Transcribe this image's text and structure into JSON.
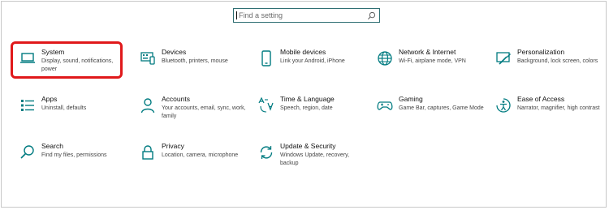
{
  "search": {
    "placeholder": "Find a setting"
  },
  "tiles": [
    {
      "title": "System",
      "desc": "Display, sound, notifications, power",
      "icon": "laptop-icon"
    },
    {
      "title": "Devices",
      "desc": "Bluetooth, printers, mouse",
      "icon": "devices-icon"
    },
    {
      "title": "Mobile devices",
      "desc": "Link your Android, iPhone",
      "icon": "phone-icon"
    },
    {
      "title": "Network & Internet",
      "desc": "Wi-Fi, airplane mode, VPN",
      "icon": "globe-icon"
    },
    {
      "title": "Personalization",
      "desc": "Background, lock screen, colors",
      "icon": "paint-icon"
    },
    {
      "title": "Apps",
      "desc": "Uninstall, defaults",
      "icon": "apps-list-icon"
    },
    {
      "title": "Accounts",
      "desc": "Your accounts, email, sync, work, family",
      "icon": "person-icon"
    },
    {
      "title": "Time & Language",
      "desc": "Speech, region, date",
      "icon": "time-language-icon"
    },
    {
      "title": "Gaming",
      "desc": "Game Bar, captures, Game Mode",
      "icon": "gamepad-icon"
    },
    {
      "title": "Ease of Access",
      "desc": "Narrator, magnifier, high contrast",
      "icon": "ease-of-access-icon"
    },
    {
      "title": "Search",
      "desc": "Find my files, permissions",
      "icon": "search-icon"
    },
    {
      "title": "Privacy",
      "desc": "Location, camera, microphone",
      "icon": "lock-icon"
    },
    {
      "title": "Update & Security",
      "desc": "Windows Update, recovery, backup",
      "icon": "sync-icon"
    }
  ],
  "colors": {
    "accent": "#007b80",
    "highlight": "#e0191b"
  }
}
